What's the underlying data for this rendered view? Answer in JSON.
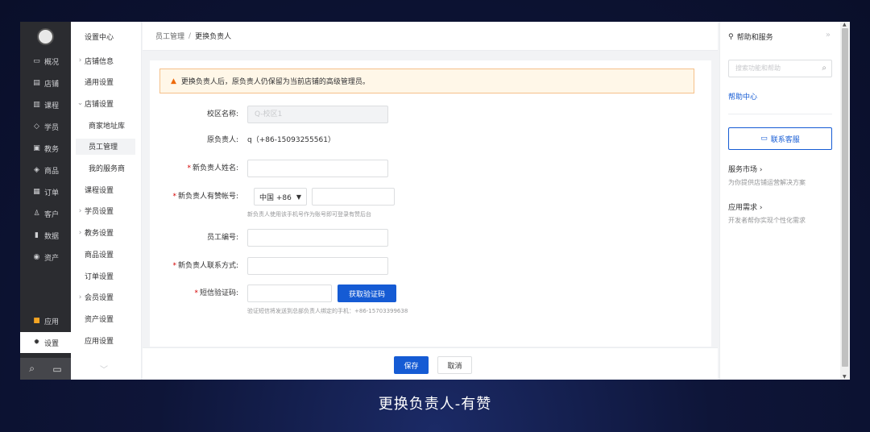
{
  "nav_main": {
    "items": [
      {
        "icon": "overview-icon",
        "glyph": "▭",
        "label": "概况"
      },
      {
        "icon": "store-icon",
        "glyph": "▤",
        "label": "店铺"
      },
      {
        "icon": "course-icon",
        "glyph": "▥",
        "label": "课程"
      },
      {
        "icon": "student-icon",
        "glyph": "◇",
        "label": "学员"
      },
      {
        "icon": "teaching-icon",
        "glyph": "▣",
        "label": "教务"
      },
      {
        "icon": "goods-icon",
        "glyph": "◈",
        "label": "商品"
      },
      {
        "icon": "order-icon",
        "glyph": "▦",
        "label": "订单"
      },
      {
        "icon": "customer-icon",
        "glyph": "♙",
        "label": "客户"
      },
      {
        "icon": "data-icon",
        "glyph": "▮",
        "label": "数据"
      },
      {
        "icon": "asset-icon",
        "glyph": "◉",
        "label": "资产"
      }
    ],
    "app": {
      "glyph": "■",
      "label": "应用"
    },
    "settings": {
      "glyph": "✹",
      "label": "设置"
    }
  },
  "nav_sub": {
    "title": "设置中心",
    "items": [
      {
        "label": "店铺信息",
        "kind": "collapsed"
      },
      {
        "label": "通用设置",
        "kind": "plain"
      },
      {
        "label": "店铺设置",
        "kind": "expanded"
      },
      {
        "label": "商家地址库",
        "kind": "sub"
      },
      {
        "label": "员工管理",
        "kind": "sub",
        "selected": true
      },
      {
        "label": "我的服务商",
        "kind": "sub"
      },
      {
        "label": "课程设置",
        "kind": "plain"
      },
      {
        "label": "学员设置",
        "kind": "collapsed"
      },
      {
        "label": "教务设置",
        "kind": "collapsed"
      },
      {
        "label": "商品设置",
        "kind": "plain"
      },
      {
        "label": "订单设置",
        "kind": "plain"
      },
      {
        "label": "会员设置",
        "kind": "collapsed"
      },
      {
        "label": "资产设置",
        "kind": "plain"
      },
      {
        "label": "应用设置",
        "kind": "plain"
      }
    ]
  },
  "breadcrumb": {
    "parent": "员工管理",
    "separator": "/",
    "current": "更换负责人"
  },
  "notice": "更换负责人后，原负责人仍保留为当前店铺的高级管理员。",
  "form": {
    "campus_label": "校区名称:",
    "campus_value": "Q-校区1",
    "old_owner_label": "原负责人:",
    "old_owner_value": "q（+86-15093255561）",
    "new_name_label": "新负责人姓名:",
    "new_account_label": "新负责人有赞帐号:",
    "country_code": "中国 +86",
    "account_hint": "新负责人使用该手机号作为账号即可登录有赞后台",
    "employee_no_label": "员工编号:",
    "contact_label": "新负责人联系方式:",
    "sms_label": "短信验证码:",
    "get_code_button": "获取验证码",
    "sms_hint": "验证短信将发送到总部负责人绑定的手机：+86-15703399638"
  },
  "footer": {
    "save": "保存",
    "cancel": "取消"
  },
  "help": {
    "title": "帮助和服务",
    "search_placeholder": "搜索功能和帮助",
    "help_center": "帮助中心",
    "customer_service": "联系客服",
    "market_title": "服务市场 ›",
    "market_desc": "为你提供店铺运营解决方案",
    "app_title": "应用需求 ›",
    "app_desc": "开发者帮你实现个性化需求"
  },
  "caption": "更换负责人-有赞",
  "colors": {
    "primary": "#155bd4",
    "warning": "#ed6a0c",
    "required": "#d40000",
    "nav_dark": "#2b2c30"
  }
}
